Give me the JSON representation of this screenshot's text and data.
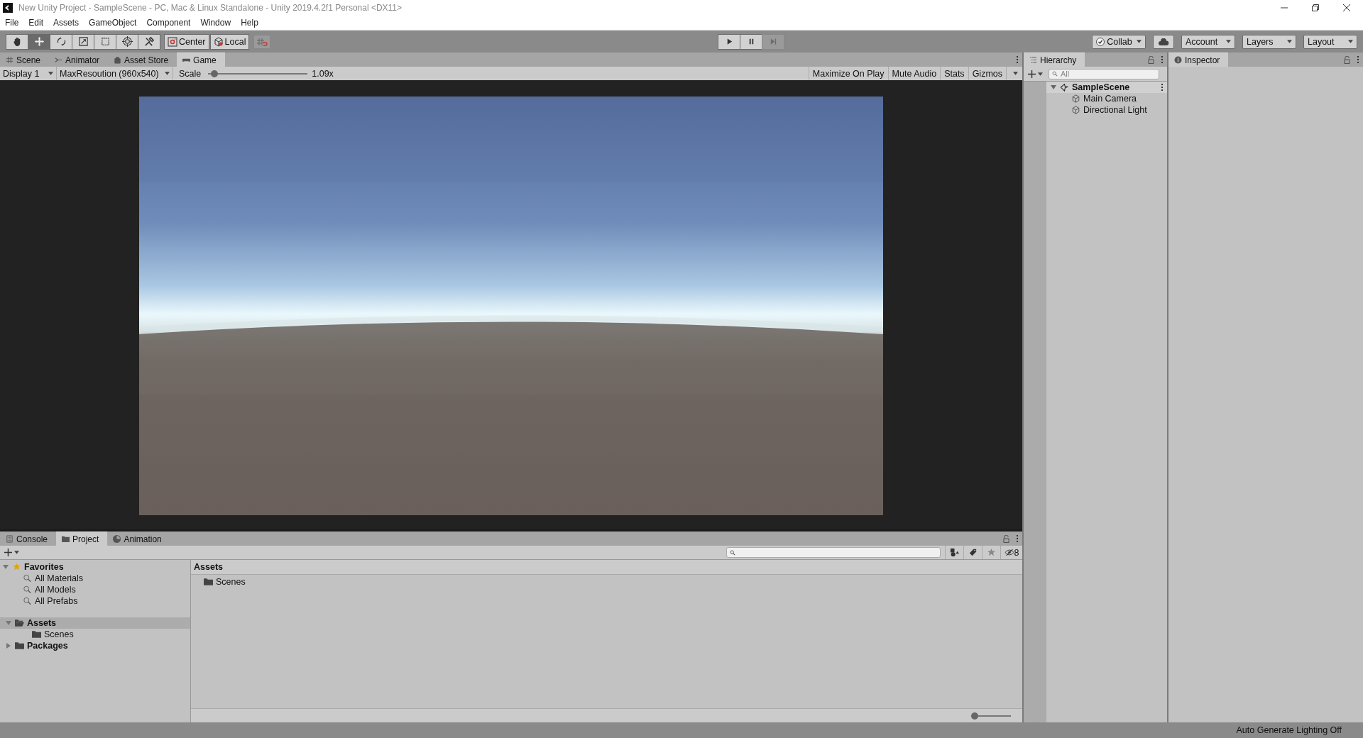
{
  "window": {
    "title": "New Unity Project - SampleScene - PC, Mac & Linux Standalone - Unity 2019.4.2f1 Personal <DX11>"
  },
  "menu": [
    "File",
    "Edit",
    "Assets",
    "GameObject",
    "Component",
    "Window",
    "Help"
  ],
  "toolbar": {
    "tools": [
      {
        "kind": "hand",
        "selected": false
      },
      {
        "kind": "move",
        "selected": true
      },
      {
        "kind": "rotate",
        "selected": false
      },
      {
        "kind": "scale",
        "selected": false
      },
      {
        "kind": "rect",
        "selected": false
      },
      {
        "kind": "transform",
        "selected": false
      },
      {
        "kind": "custom",
        "selected": false
      }
    ],
    "pivot": [
      "Center",
      "Local"
    ],
    "play": [
      {
        "kind": "play",
        "disabled": false
      },
      {
        "kind": "pause",
        "disabled": false
      },
      {
        "kind": "step",
        "disabled": true
      }
    ],
    "collab": "Collab",
    "account": "Account",
    "layers": "Layers",
    "layout": "Layout"
  },
  "view_tabs": [
    {
      "label": "Scene",
      "kind": "scene",
      "selected": false
    },
    {
      "label": "Animator",
      "kind": "animator",
      "selected": false
    },
    {
      "label": "Asset Store",
      "kind": "store",
      "selected": false
    },
    {
      "label": "Game",
      "kind": "game",
      "selected": true
    }
  ],
  "game_toolbar": {
    "display": "Display 1",
    "resolution": "MaxResoution (960x540)",
    "scale_label": "Scale",
    "scale": {
      "level": 0.03
    },
    "scale_value": "1.09x",
    "toggles": [
      "Maximize On Play",
      "Mute Audio",
      "Stats",
      "Gizmos"
    ]
  },
  "hierarchy": {
    "title": "Hierarchy",
    "search": {
      "placeholder": "All"
    },
    "tree": [
      {
        "label": "SampleScene",
        "kind": "scene",
        "expanded": true,
        "children": [
          {
            "label": "Main Camera",
            "kind": "object"
          },
          {
            "label": "Directional Light",
            "kind": "object"
          }
        ]
      }
    ]
  },
  "inspector": {
    "title": "Inspector"
  },
  "bottom_tabs": [
    {
      "label": "Console",
      "kind": "console",
      "selected": false
    },
    {
      "label": "Project",
      "kind": "project",
      "selected": true
    },
    {
      "label": "Animation",
      "kind": "animation",
      "selected": false
    }
  ],
  "project": {
    "favorites": {
      "label": "Favorites",
      "expanded": true,
      "items": [
        "All Materials",
        "All Models",
        "All Prefabs"
      ]
    },
    "tree": [
      {
        "label": "Assets",
        "expanded": true,
        "selected": true,
        "children": [
          {
            "label": "Scenes",
            "selected": false
          }
        ]
      },
      {
        "label": "Packages",
        "expanded": false,
        "selected": false
      }
    ],
    "breadcrumb": "Assets",
    "items": [
      "Scenes"
    ],
    "hidden_count": "8",
    "icon_size": {
      "level": 0.0
    }
  },
  "status_bar": "Auto Generate Lighting Off"
}
